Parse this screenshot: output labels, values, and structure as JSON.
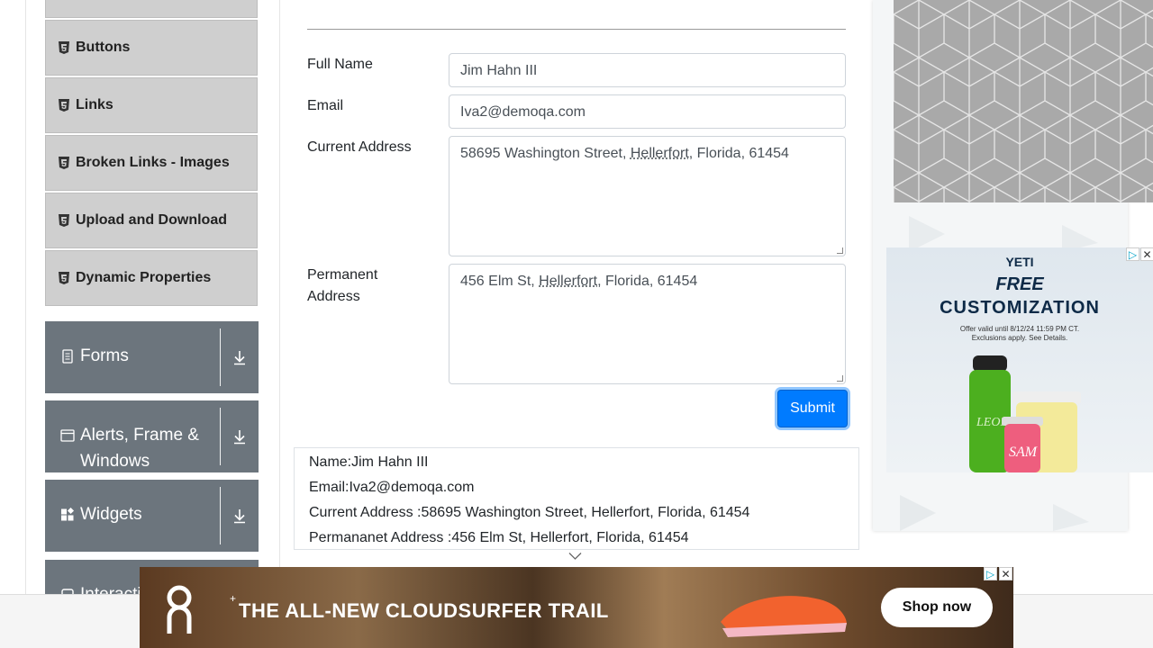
{
  "sidebar": {
    "sub_items": [
      {
        "label": "Buttons"
      },
      {
        "label": "Links"
      },
      {
        "label": "Broken Links - Images"
      },
      {
        "label": "Upload and Download"
      },
      {
        "label": "Dynamic Properties"
      }
    ],
    "groups": [
      {
        "label": "Forms"
      },
      {
        "label": "Alerts, Frame & Windows"
      },
      {
        "label": "Widgets"
      },
      {
        "label": "Interactions"
      }
    ]
  },
  "form": {
    "full_name_label": "Full Name",
    "full_name_value": "Jim Hahn III",
    "email_label": "Email",
    "email_value": "Iva2@demoqa.com",
    "current_address_label": "Current Address",
    "current_address_pre": "58695 Washington Street, ",
    "current_address_city": "Hellerfort",
    "current_address_post": ", Florida, 61454",
    "permanent_address_label": "Permanent Address",
    "permanent_address_pre": "456 Elm St, ",
    "permanent_address_city": "Hellerfort",
    "permanent_address_post": ", Florida, 61454",
    "submit_label": "Submit"
  },
  "output": {
    "name": "Name:Jim Hahn III",
    "email": "Email:Iva2@demoqa.com",
    "current_address": "Current Address :58695 Washington Street, Hellerfort, Florida, 61454",
    "permanent_address": "Permananet Address :456 Elm St, Hellerfort, Florida, 61454"
  },
  "ads": {
    "right": {
      "brand": "YETI",
      "headline1": "FREE",
      "headline2": "CUSTOMIZATION",
      "fine_print1": "Offer valid until 8/12/24 11:59 PM CT.",
      "fine_print2": "Exclusions apply. See Details."
    },
    "bottom": {
      "headline": "THE ALL-NEW CLOUDSURFER TRAIL",
      "cta": "Shop now"
    }
  },
  "colors": {
    "sidebar_group_bg": "#6c757d",
    "sidebar_item_bg": "#cfcfcf",
    "submit_bg": "#007bff"
  }
}
